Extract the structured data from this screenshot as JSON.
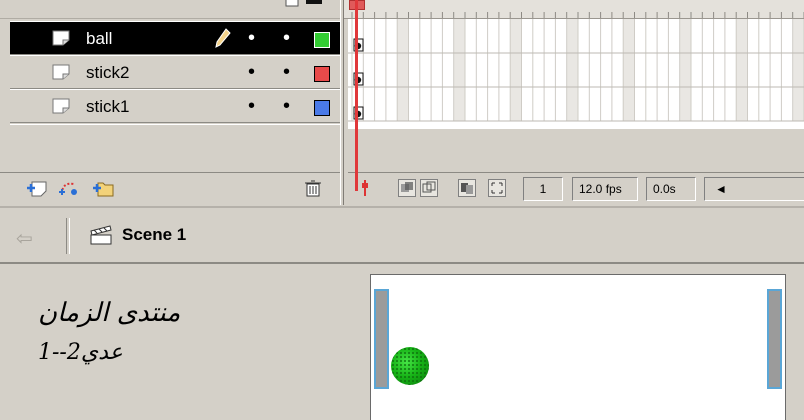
{
  "timeline": {
    "layers": [
      {
        "name": "ball",
        "selected": true,
        "color": "#33cc33"
      },
      {
        "name": "stick2",
        "selected": false,
        "color": "#e84a4a"
      },
      {
        "name": "stick1",
        "selected": false,
        "color": "#4a7ae8"
      }
    ],
    "eye_dot": "•",
    "lock_dot": "•",
    "current_frame": "1",
    "fps": "12.0 fps",
    "elapsed": "0.0s",
    "scroll_left": "◄"
  },
  "scene_bar": {
    "back_arrow": "⇦",
    "scene_label": "Scene 1"
  },
  "stage_text": {
    "line1": "منتدى الزمان",
    "line2": "عدي2--1"
  },
  "colors": {
    "panel": "#d4d0c8",
    "playhead": "#e0383a",
    "stick_fill": "#9b9b9b",
    "stick_border": "#5aa6d6",
    "ball": "#17b417"
  },
  "icons": [
    "layer-icon",
    "pencil-icon",
    "trash-icon",
    "add-layer-icon",
    "add-guide-layer-icon",
    "add-folder-icon",
    "center-frame-icon",
    "onion-skin-icon",
    "onion-outline-icon",
    "edit-multiple-frames-icon",
    "modify-markers-icon",
    "back-arrow-icon",
    "scene-icon"
  ]
}
